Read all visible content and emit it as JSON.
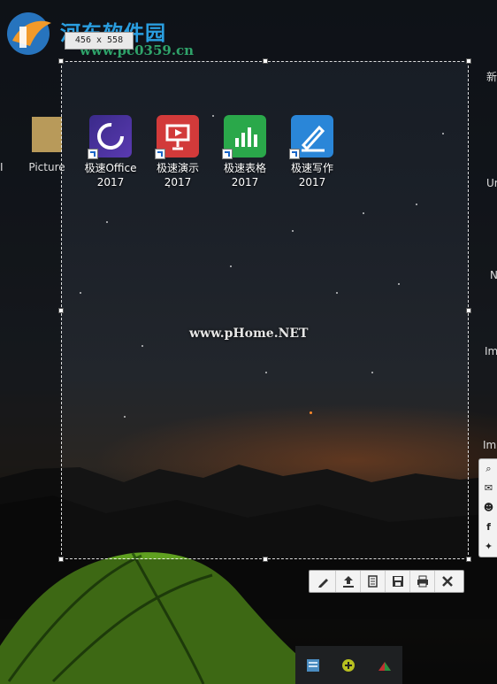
{
  "watermark": {
    "logo_text": "河东软件园",
    "logo_url": "www.pc0359.cn",
    "center_text": "www.pHome.NET"
  },
  "selection": {
    "size_label": "456 x 558"
  },
  "desktop": {
    "left_icon_label": "Picture",
    "left_edge_char": "I",
    "icons": [
      {
        "line1": "极速Office",
        "line2": "2017",
        "color": "#4a2a8a"
      },
      {
        "line1": "极速演示",
        "line2": "2017",
        "color": "#d23a3a"
      },
      {
        "line1": "极速表格",
        "line2": "2017",
        "color": "#2aa84a"
      },
      {
        "line1": "极速写作",
        "line2": "2017",
        "color": "#2a86d8"
      }
    ],
    "right_edge": [
      "新",
      "Ur",
      "N",
      "Im",
      "Im"
    ]
  },
  "share_panel": [
    "search-icon",
    "mail-icon",
    "reddit-icon",
    "facebook-icon",
    "twitter-icon"
  ],
  "toolbar": [
    "edit-icon",
    "upload-icon",
    "copy-icon",
    "save-icon",
    "print-icon",
    "close-icon"
  ]
}
